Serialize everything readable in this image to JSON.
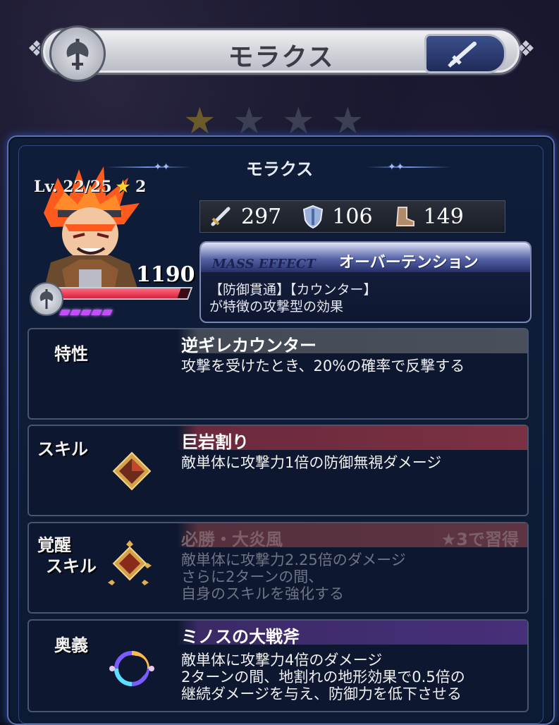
{
  "header": {
    "title": "モラクス"
  },
  "character": {
    "name": "モラクス",
    "level": "Lv. 22/25",
    "rarity": "2",
    "hp": "1190",
    "hp_fraction": 0.93
  },
  "stats": {
    "attack": "297",
    "defense": "106",
    "speed": "149"
  },
  "mass_effect": {
    "tag": "MASS EFFECT",
    "name": "オーバーテンション",
    "desc_line1": "【防御貫通】【カウンター】",
    "desc_line2": "が特徴の攻撃型の効果"
  },
  "trait": {
    "label": "特性",
    "title": "逆ギレカウンター",
    "desc": "攻撃を受けたとき、20%の確率で反撃する"
  },
  "skill": {
    "label": "スキル",
    "title": "巨岩割り",
    "desc": "敵単体に攻撃力1倍の防御無視ダメージ"
  },
  "awaken_skill": {
    "label_line1": "覚醒",
    "label_line2": "スキル",
    "title": "必勝・大炎風",
    "learn": "★3で習得",
    "desc_line1": "敵単体に攻撃力2.25倍のダメージ",
    "desc_line2": "さらに2ターンの間、",
    "desc_line3": "自身のスキルを強化する"
  },
  "ultimate": {
    "label": "奥義",
    "title": "ミノスの大戦斧",
    "desc_line1": "敵単体に攻撃力4倍のダメージ",
    "desc_line2": "2ターンの間、地割れの地形効果で0.5倍の",
    "desc_line3": "継続ダメージを与え、防御力を低下させる"
  },
  "icons": [
    "axe-icon",
    "sword-icon",
    "shield-icon",
    "boot-icon",
    "star-icon",
    "gem-icon",
    "moon-orb-icon"
  ],
  "colors": {
    "hp": "#d92040",
    "rarity_star": "#ffd23a",
    "skill_stripe": "#7a3143",
    "ultimate_stripe": "#46307a"
  }
}
